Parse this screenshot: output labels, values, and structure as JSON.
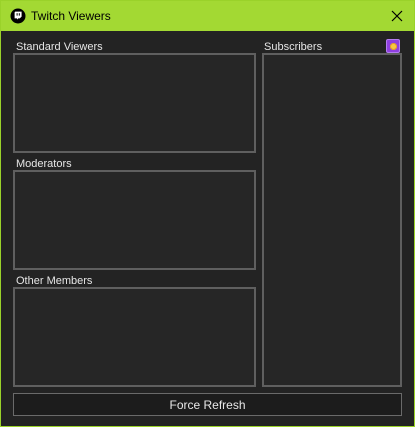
{
  "window": {
    "title": "Twitch Viewers",
    "app_icon": "twitch-icon",
    "accent_color": "#a3d933"
  },
  "lists": {
    "standard_viewers": {
      "label": "Standard Viewers",
      "items": []
    },
    "moderators": {
      "label": "Moderators",
      "items": []
    },
    "other_members": {
      "label": "Other Members",
      "items": []
    },
    "subscribers": {
      "label": "Subscribers",
      "items": [],
      "badge_icon": "subscriber-badge-icon"
    }
  },
  "actions": {
    "refresh_label": "Force Refresh"
  }
}
